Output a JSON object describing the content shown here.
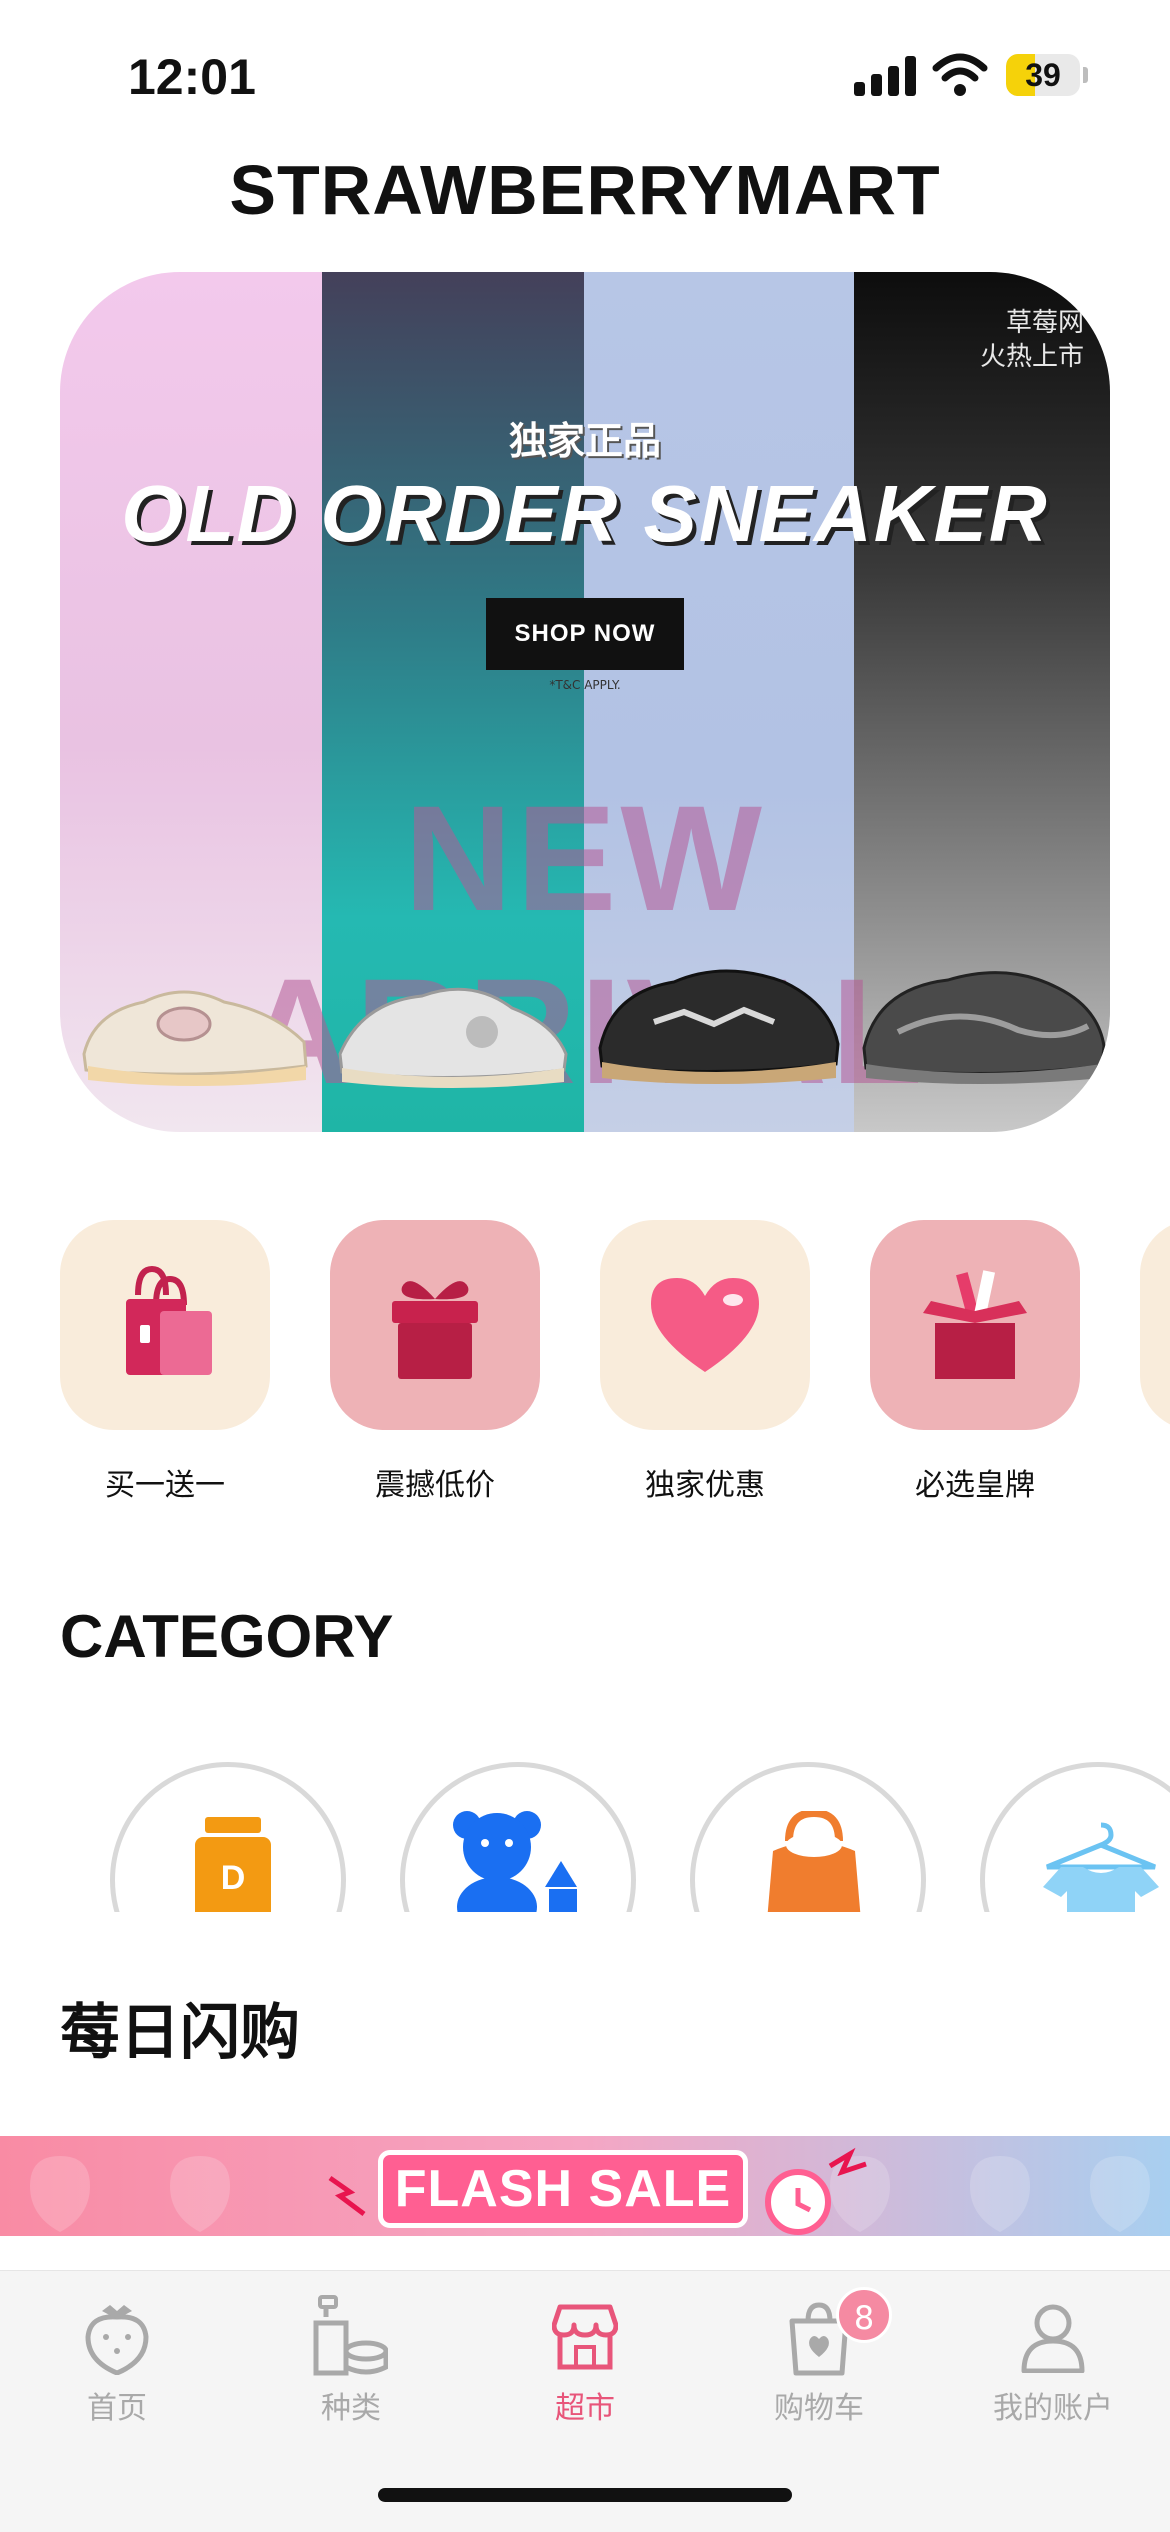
{
  "status_bar": {
    "time": "12:01",
    "battery": "39",
    "battery_level": 0.39
  },
  "header": {
    "title": "STRAWBERRYMART"
  },
  "hero": {
    "corner_text_line1": "草莓网",
    "corner_text_line2": "火热上市",
    "subtitle": "独家正品",
    "headline": "OLD ORDER SNEAKER",
    "button": "SHOP NOW",
    "terms": "*T&C APPLY.",
    "arrival": "NEW ARRIVAL"
  },
  "promos": [
    {
      "label": "买一送一",
      "icon": "shopping-bags-icon"
    },
    {
      "label": "震撼低价",
      "icon": "gift-box-icon"
    },
    {
      "label": "独家优惠",
      "icon": "heart-icon"
    },
    {
      "label": "必选皇牌",
      "icon": "open-gift-box-icon"
    }
  ],
  "category": {
    "title": "CATEGORY",
    "items": [
      {
        "icon": "supplement-bottle-icon"
      },
      {
        "icon": "teddy-bear-icon"
      },
      {
        "icon": "handbag-icon"
      },
      {
        "icon": "clothes-hanger-icon"
      }
    ]
  },
  "flash": {
    "title": "莓日闪购",
    "banner_text": "FLASH SALE"
  },
  "tabbar": {
    "items": [
      {
        "label": "首页",
        "icon": "strawberry-icon",
        "active": false
      },
      {
        "label": "种类",
        "icon": "cosmetics-icon",
        "active": false
      },
      {
        "label": "超市",
        "icon": "store-icon",
        "active": true
      },
      {
        "label": "购物车",
        "icon": "shopping-bag-icon",
        "active": false,
        "badge": "8"
      },
      {
        "label": "我的账户",
        "icon": "user-icon",
        "active": false
      }
    ]
  },
  "colors": {
    "accent": "#e8557a",
    "inactive": "#a9a9a9",
    "badge": "#f58aa2"
  }
}
